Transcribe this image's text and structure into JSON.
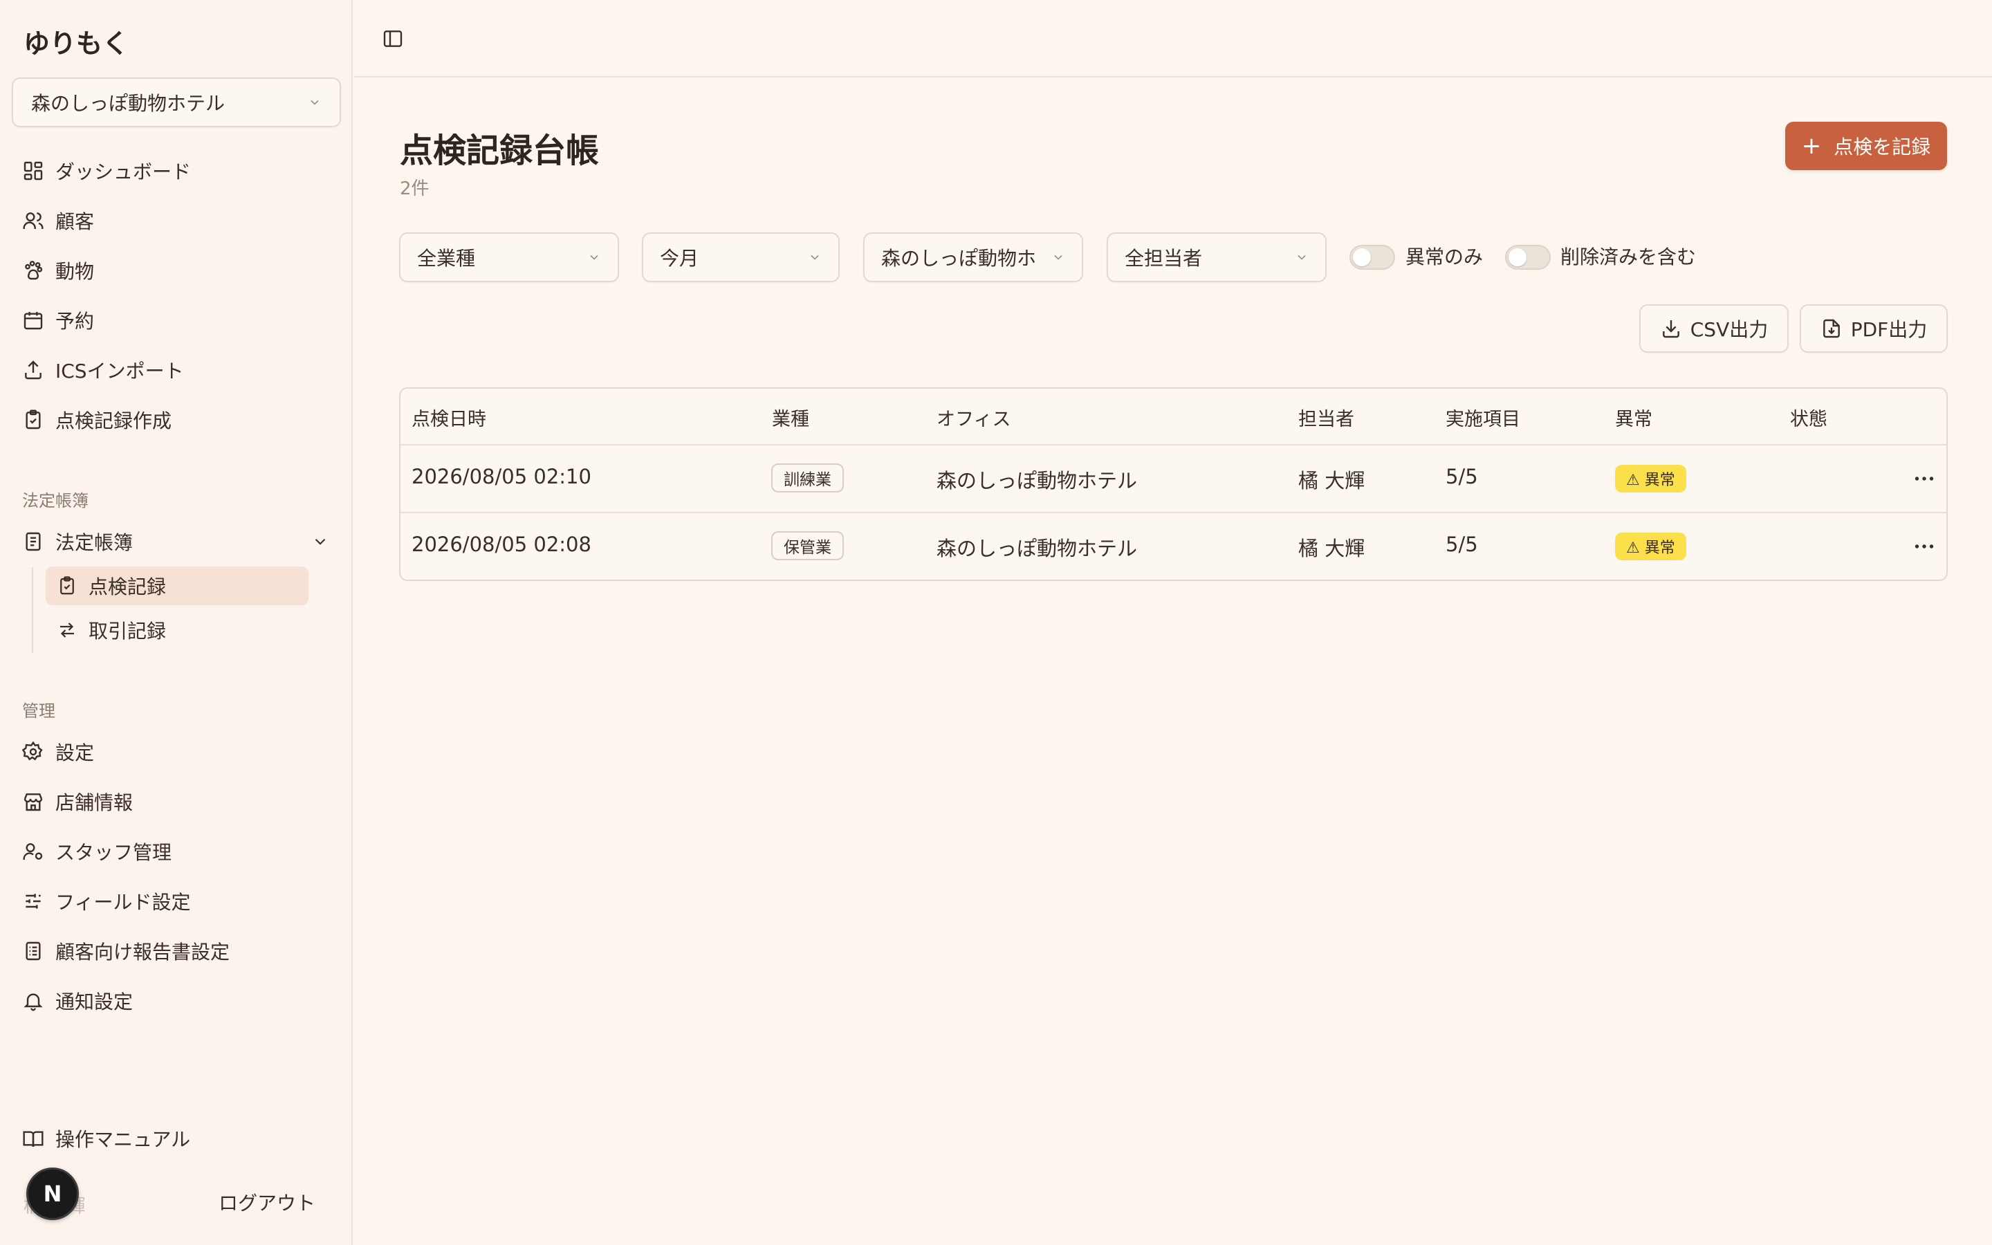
{
  "app": {
    "title": "ゆりもく"
  },
  "sidebar": {
    "org_select": "森のしっぽ動物ホテル",
    "main_items": [
      {
        "label": "ダッシュボード",
        "icon": "dashboard-icon"
      },
      {
        "label": "顧客",
        "icon": "users-icon"
      },
      {
        "label": "動物",
        "icon": "paw-icon"
      },
      {
        "label": "予約",
        "icon": "calendar-icon"
      },
      {
        "label": "ICSインポート",
        "icon": "upload-icon"
      },
      {
        "label": "点検記録作成",
        "icon": "clipboard-check-icon"
      }
    ],
    "legal_section": "法定帳簿",
    "legal_group": "法定帳簿",
    "legal_sub": [
      {
        "label": "点検記録",
        "icon": "clipboard-check-icon",
        "active": true
      },
      {
        "label": "取引記録",
        "icon": "arrows-swap-icon",
        "active": false
      }
    ],
    "admin_section": "管理",
    "admin_items": [
      {
        "label": "設定",
        "icon": "gear-icon"
      },
      {
        "label": "店舗情報",
        "icon": "store-icon"
      },
      {
        "label": "スタッフ管理",
        "icon": "user-cog-icon"
      },
      {
        "label": "フィールド設定",
        "icon": "sliders-icon"
      },
      {
        "label": "顧客向け報告書設定",
        "icon": "report-icon"
      },
      {
        "label": "通知設定",
        "icon": "bell-icon"
      }
    ],
    "manual": "操作マニュアル",
    "avatar_letter": "N",
    "user_name": "橘 大輝",
    "logout": "ログアウト"
  },
  "main": {
    "title": "点検記録台帳",
    "count": "2件",
    "record_button": "点検を記録",
    "filters": {
      "business_type": "全業種",
      "period": "今月",
      "office": "森のしっぽ動物ホ",
      "staff": "全担当者"
    },
    "toggles": {
      "abnormal_only": "異常のみ",
      "include_deleted": "削除済みを含む"
    },
    "csv_button": "CSV出力",
    "pdf_button": "PDF出力",
    "table": {
      "headers": [
        "点検日時",
        "業種",
        "オフィス",
        "担当者",
        "実施項目",
        "異常",
        "状態"
      ],
      "rows": [
        {
          "datetime": "2026/08/05 02:10",
          "type": "訓練業",
          "office": "森のしっぽ動物ホテル",
          "staff": "橘 大輝",
          "items": "5/5",
          "abnormal": "⚠ 異常",
          "status": ""
        },
        {
          "datetime": "2026/08/05 02:08",
          "type": "保管業",
          "office": "森のしっぽ動物ホテル",
          "staff": "橘 大輝",
          "items": "5/5",
          "abnormal": "⚠ 異常",
          "status": ""
        }
      ]
    }
  },
  "colors": {
    "accent": "#c8613f",
    "warning": "#fbe04b",
    "background": "#fdf6ee"
  }
}
